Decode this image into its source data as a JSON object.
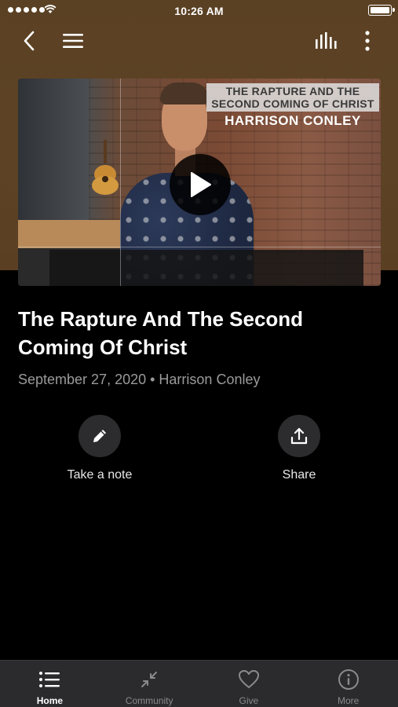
{
  "status_bar": {
    "time": "10:26 AM"
  },
  "video": {
    "overlay_line1": "THE RAPTURE AND THE",
    "overlay_line2": "SECOND COMING OF CHRIST",
    "overlay_name": "HARRISON CONLEY"
  },
  "sermon": {
    "title": "The Rapture And The Second Coming Of Christ",
    "meta": "September 27, 2020 • Harrison Conley"
  },
  "actions": [
    {
      "label": "Take a note",
      "icon": "pencil-icon"
    },
    {
      "label": "Share",
      "icon": "share-icon"
    }
  ],
  "tabs": [
    {
      "label": "Home",
      "icon": "list-icon",
      "active": true
    },
    {
      "label": "Community",
      "icon": "collapse-arrows-icon",
      "active": false
    },
    {
      "label": "Give",
      "icon": "heart-icon",
      "active": false
    },
    {
      "label": "More",
      "icon": "info-icon",
      "active": false
    }
  ],
  "colors": {
    "header_brown": "#5b4124",
    "background": "#000000",
    "tab_bar": "#2b2b2d",
    "meta_gray": "#9a9a9a"
  }
}
